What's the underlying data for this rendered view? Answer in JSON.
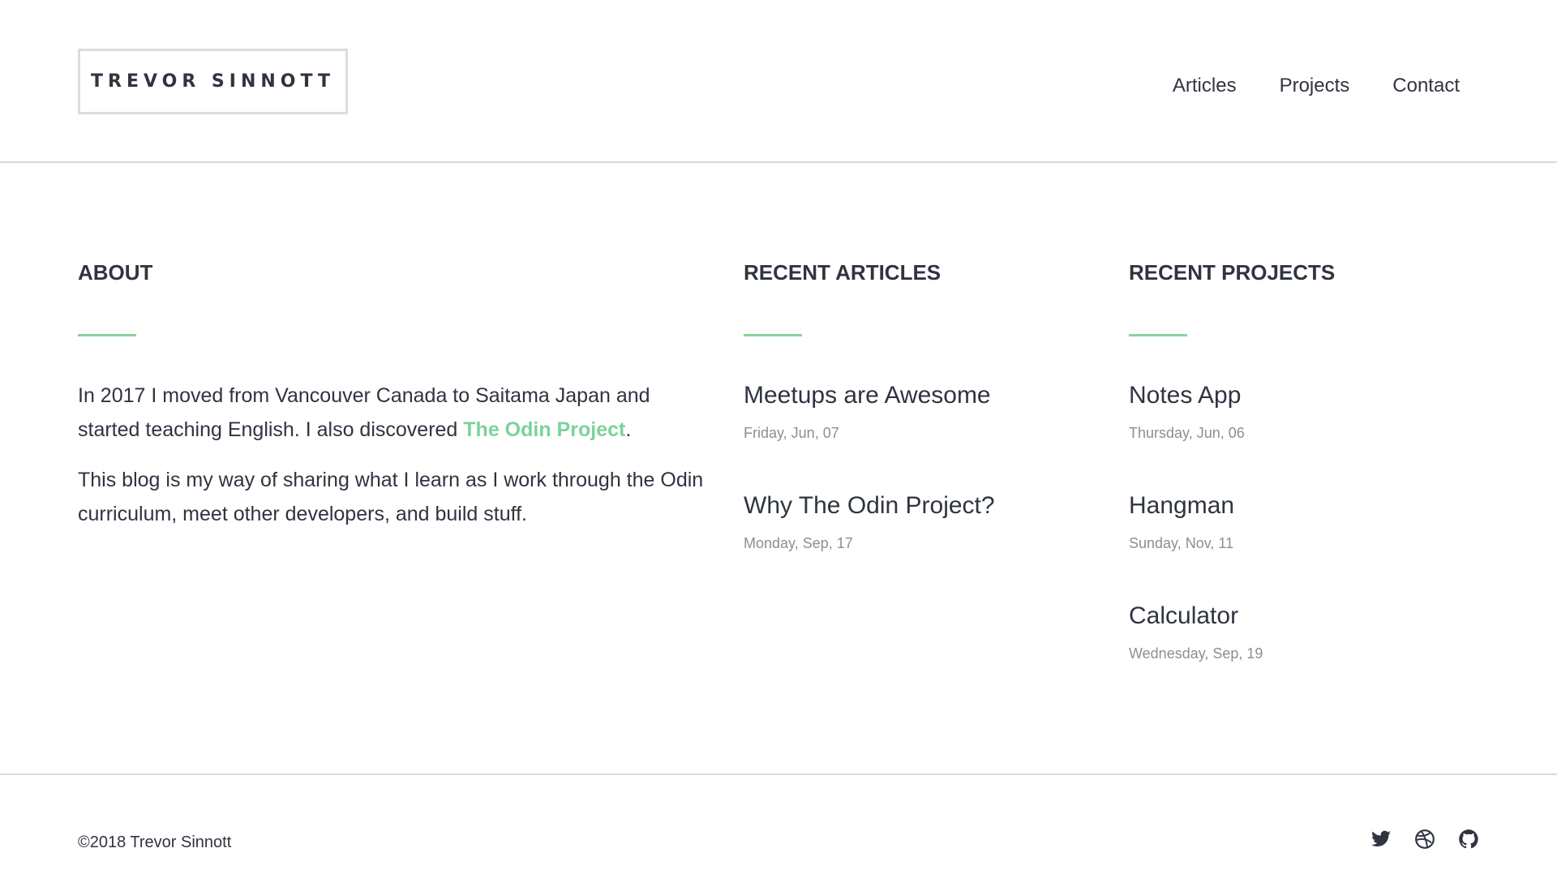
{
  "header": {
    "logo": "TREVOR SINNOTT",
    "nav": [
      "Articles",
      "Projects",
      "Contact"
    ]
  },
  "about": {
    "title": "ABOUT",
    "p1_before": "In 2017 I moved from Vancouver Canada to Saitama Japan and started teaching English. I also discovered ",
    "p1_link": "The Odin Project",
    "p1_after": ".",
    "p2": "This blog is my way of sharing what I learn as I work through the Odin curriculum, meet other developers, and build stuff."
  },
  "articles": {
    "title": "RECENT ARTICLES",
    "items": [
      {
        "title": "Meetups are Awesome",
        "date": "Friday, Jun, 07"
      },
      {
        "title": "Why The Odin Project?",
        "date": "Monday, Sep, 17"
      }
    ]
  },
  "projects": {
    "title": "RECENT PROJECTS",
    "items": [
      {
        "title": "Notes App",
        "date": "Thursday, Jun, 06"
      },
      {
        "title": "Hangman",
        "date": "Sunday, Nov, 11"
      },
      {
        "title": "Calculator",
        "date": "Wednesday, Sep, 19"
      }
    ]
  },
  "footer": {
    "copyright": "©2018 Trevor Sinnott",
    "social_icons": [
      "twitter-icon",
      "dribbble-icon",
      "github-icon"
    ]
  },
  "colors": {
    "accent": "#86d59b",
    "text": "#2f3440",
    "muted": "#8a8f96",
    "divider": "#d9d9d9"
  }
}
